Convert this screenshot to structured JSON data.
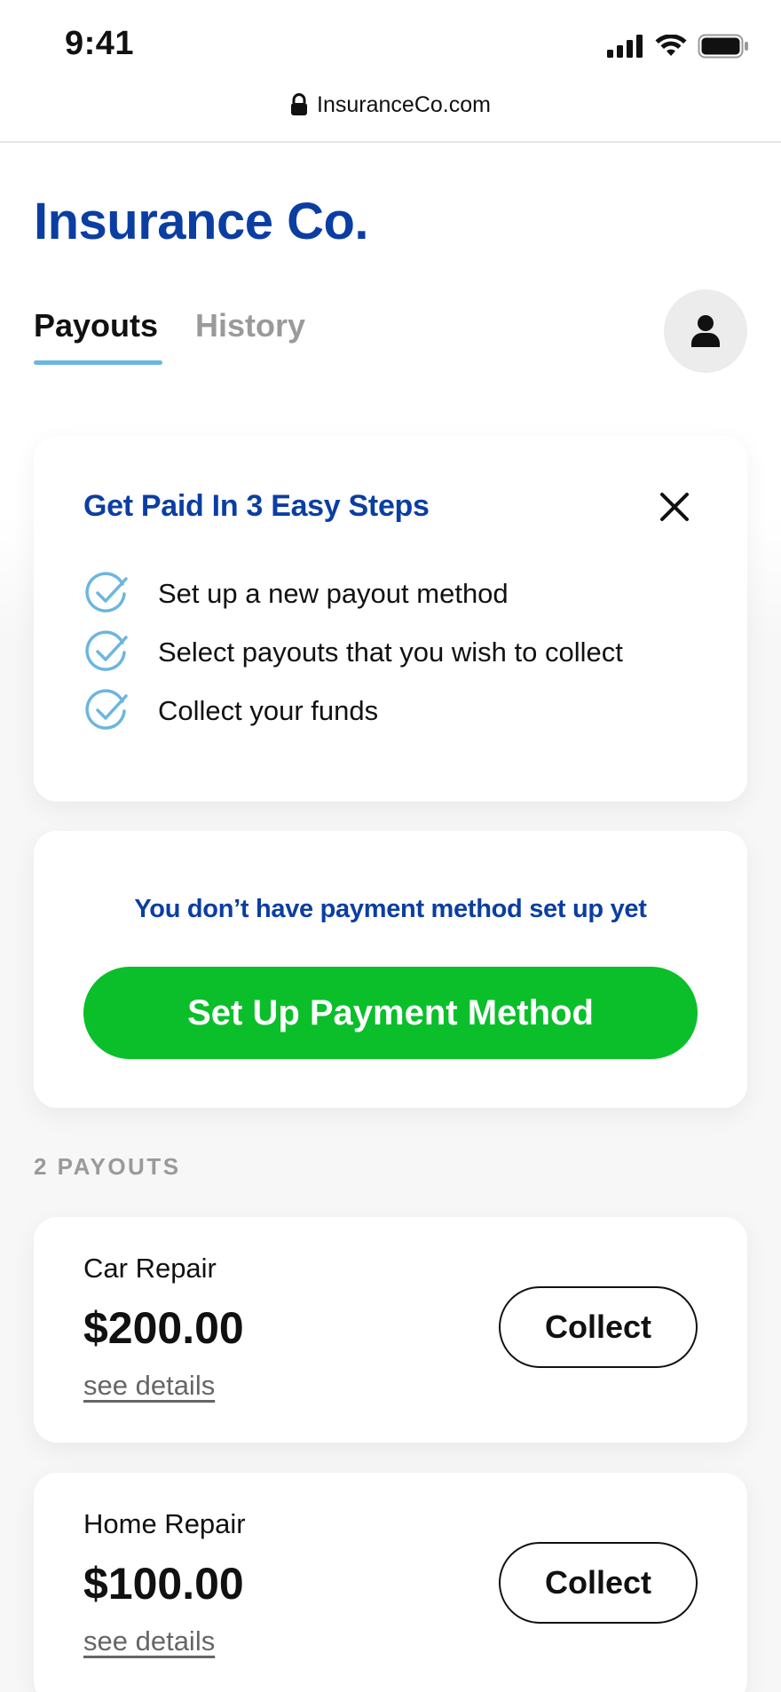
{
  "status_bar": {
    "time": "9:41",
    "icons": [
      "cellular-signal-icon",
      "wifi-icon",
      "battery-icon"
    ]
  },
  "url_bar": {
    "url": "InsuranceCo.com",
    "icon": "lock-icon"
  },
  "header": {
    "brand": "Insurance Co.",
    "tabs": [
      {
        "label": "Payouts",
        "active": true
      },
      {
        "label": "History",
        "active": false
      }
    ],
    "avatar_icon": "user-icon"
  },
  "steps_card": {
    "title": "Get Paid In 3 Easy Steps",
    "close_icon": "close-icon",
    "steps": [
      {
        "label": "Set up a new payout method",
        "icon": "check-circle-icon"
      },
      {
        "label": "Select payouts that you wish to collect",
        "icon": "check-circle-icon"
      },
      {
        "label": "Collect your funds",
        "icon": "check-circle-icon"
      }
    ]
  },
  "method_card": {
    "message": "You don’t have payment method set up yet",
    "button_label": "Set Up Payment Method"
  },
  "payouts": {
    "count_label": "2 PAYOUTS",
    "items": [
      {
        "name": "Car Repair",
        "amount": "$200.00",
        "details_link": "see details",
        "button_label": "Collect"
      },
      {
        "name": "Home Repair",
        "amount": "$100.00",
        "details_link": "see details",
        "button_label": "Collect"
      }
    ]
  },
  "colors": {
    "brand_blue": "#0b3ea3",
    "accent_green": "#0abf2a",
    "tab_underline": "#6bb6df",
    "check_blue": "#6bb6df"
  }
}
